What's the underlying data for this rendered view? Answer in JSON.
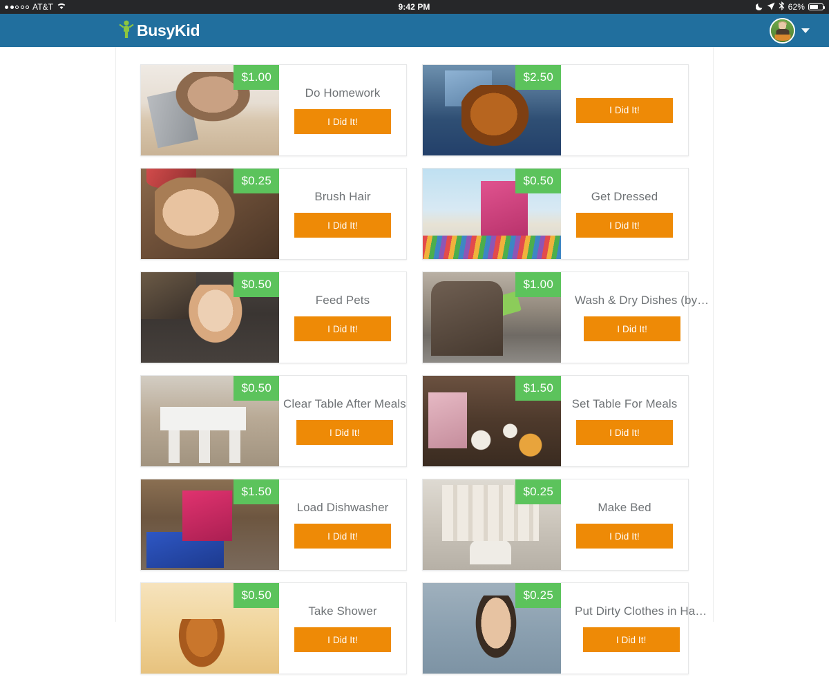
{
  "status_bar": {
    "signal_dots": [
      true,
      true,
      false,
      false,
      false
    ],
    "carrier": "AT&T",
    "wifi_icon": "wifi-icon",
    "time": "9:42 PM",
    "moon_icon": "moon-icon",
    "location_icon": "location-arrow-icon",
    "bluetooth_icon": "bluetooth-icon",
    "battery_percent": "62%"
  },
  "header": {
    "brand_name": "BusyKid",
    "logo_icon": "busykid-person-icon",
    "avatar_name": "avatar",
    "dropdown_icon": "chevron-down-icon"
  },
  "colors": {
    "header_blue": "#216f9e",
    "price_green": "#5cc35c",
    "button_orange": "#ee8a06",
    "title_gray": "#6f7376",
    "status_bar": "#262729"
  },
  "chores": [
    {
      "title": "Do Homework",
      "price": "$1.00",
      "button": "I Did It!",
      "image": "img-homework",
      "truncated": false
    },
    {
      "title": "",
      "price": "$2.50",
      "button": "I Did It!",
      "image": "img-violin",
      "truncated": false
    },
    {
      "title": "Brush Hair",
      "price": "$0.25",
      "button": "I Did It!",
      "image": "img-brush",
      "truncated": false
    },
    {
      "title": "Get Dressed",
      "price": "$0.50",
      "button": "I Did It!",
      "image": "img-dressed",
      "truncated": false
    },
    {
      "title": "Feed Pets",
      "price": "$0.50",
      "button": "I Did It!",
      "image": "img-pets",
      "truncated": false
    },
    {
      "title": "Wash & Dry Dishes (by…",
      "price": "$1.00",
      "button": "I Did It!",
      "image": "img-dishes",
      "truncated": true
    },
    {
      "title": "Clear Table After Meals",
      "price": "$0.50",
      "button": "I Did It!",
      "image": "img-cleartable",
      "truncated": false
    },
    {
      "title": "Set Table For Meals",
      "price": "$1.50",
      "button": "I Did It!",
      "image": "img-settable",
      "truncated": false
    },
    {
      "title": "Load Dishwasher",
      "price": "$1.50",
      "button": "I Did It!",
      "image": "img-loaddish",
      "truncated": false
    },
    {
      "title": "Make Bed",
      "price": "$0.25",
      "button": "I Did It!",
      "image": "img-makebed",
      "truncated": false
    },
    {
      "title": "Take Shower",
      "price": "$0.50",
      "button": "I Did It!",
      "image": "img-shower",
      "truncated": false
    },
    {
      "title": "Put Dirty Clothes in Ha…",
      "price": "$0.25",
      "button": "I Did It!",
      "image": "img-laundry",
      "truncated": true
    }
  ]
}
